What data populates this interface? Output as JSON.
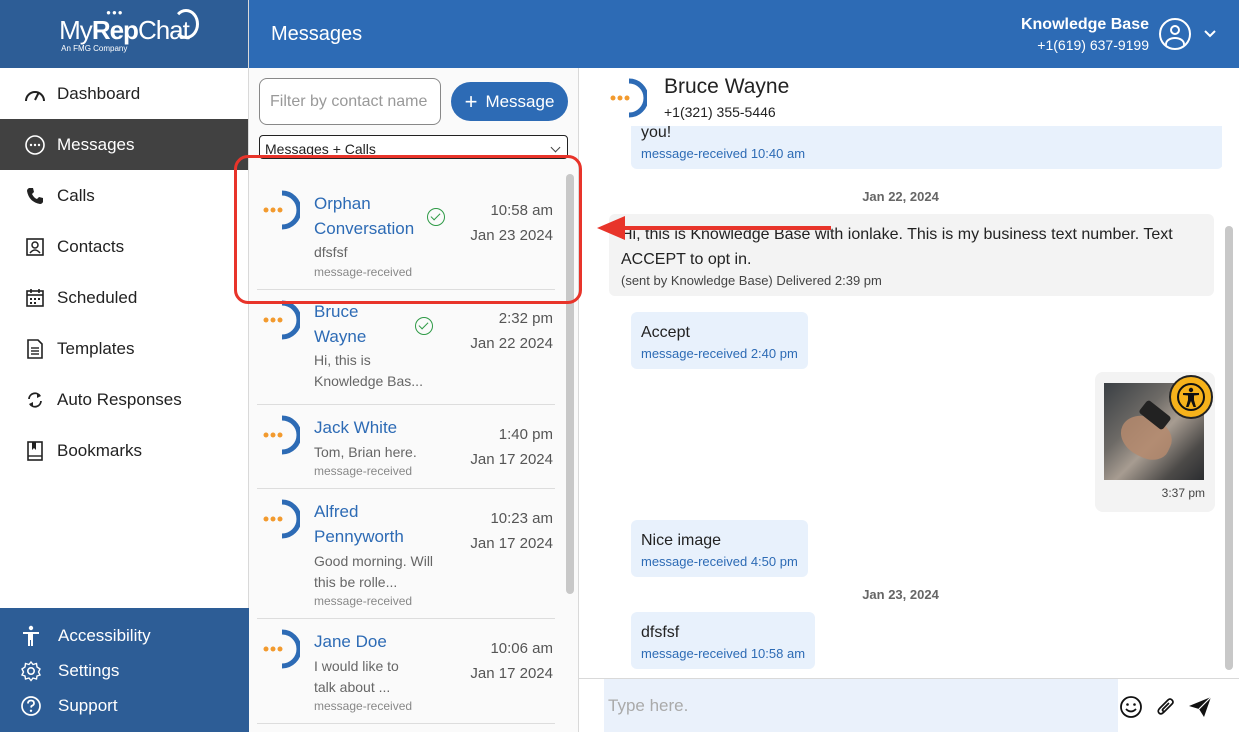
{
  "brand": {
    "name_regular": "My",
    "name_bold": "Rep",
    "name_end": "Chat",
    "tagline": "An FMG Company"
  },
  "sidebar": {
    "items": [
      {
        "label": "Dashboard",
        "icon": "gauge-icon",
        "active": false
      },
      {
        "label": "Messages",
        "icon": "chat-icon",
        "active": true
      },
      {
        "label": "Calls",
        "icon": "phone-icon",
        "active": false
      },
      {
        "label": "Contacts",
        "icon": "contact-card-icon",
        "active": false
      },
      {
        "label": "Scheduled",
        "icon": "calendar-icon",
        "active": false
      },
      {
        "label": "Templates",
        "icon": "document-icon",
        "active": false
      },
      {
        "label": "Auto Responses",
        "icon": "refresh-icon",
        "active": false
      },
      {
        "label": "Bookmarks",
        "icon": "bookmark-icon",
        "active": false
      }
    ],
    "bottom": [
      {
        "label": "Accessibility",
        "icon": "accessibility-icon"
      },
      {
        "label": "Settings",
        "icon": "gear-icon"
      },
      {
        "label": "Support",
        "icon": "help-circle-icon"
      }
    ]
  },
  "header": {
    "title": "Messages",
    "account_name": "Knowledge Base",
    "account_phone": "+1(619) 637-9199"
  },
  "list": {
    "filter_placeholder": "Filter by contact name",
    "new_button": "Message",
    "type_select": "Messages + Calls",
    "conversations": [
      {
        "name": "Orphan Conversation",
        "time": "10:58 am",
        "date": "Jan 23 2024",
        "preview": "dfsfsf",
        "status": "message-received",
        "verified": true
      },
      {
        "name": "Bruce Wayne",
        "time": "2:32 pm",
        "date": "Jan 22 2024",
        "preview": "Hi, this is Knowledge Bas...",
        "status": "",
        "verified": true
      },
      {
        "name": "Jack White",
        "time": "1:40 pm",
        "date": "Jan 17 2024",
        "preview": "Tom, Brian here.",
        "status": "message-received",
        "verified": false
      },
      {
        "name": "Alfred Pennyworth",
        "time": "10:23 am",
        "date": "Jan 17 2024",
        "preview": "Good morning. Will this be rolle...",
        "status": "message-received",
        "verified": false
      },
      {
        "name": "Jane Doe",
        "time": "10:06 am",
        "date": "Jan 17 2024",
        "preview": "I would like to talk about ...",
        "status": "message-received",
        "verified": false
      }
    ]
  },
  "chat": {
    "contact_name": "Bruce Wayne",
    "contact_phone": "+1(321) 355-5446",
    "messages": [
      {
        "text": "you!",
        "meta": "message-received 10:40 am"
      },
      {
        "date": "Jan 22, 2024"
      },
      {
        "text": "Hi, this is Knowledge Base with ionlake. This is my business text number. Text ACCEPT to opt in.",
        "meta": "(sent by Knowledge Base) Delivered 2:39 pm"
      },
      {
        "text": "Accept",
        "meta": "message-received 2:40 pm"
      },
      {
        "image_time": "3:37 pm"
      },
      {
        "text": "Nice image",
        "meta": "message-received 4:50 pm"
      },
      {
        "date": "Jan 23, 2024"
      },
      {
        "text": "dfsfsf",
        "meta": "message-received 10:58 am"
      }
    ],
    "composer_placeholder": "Type here."
  },
  "colors": {
    "brand_blue": "#2d6bb5",
    "sidebar_blue": "#2d5d96",
    "highlight_red": "#e8342a",
    "check_green": "#2e9a46"
  }
}
